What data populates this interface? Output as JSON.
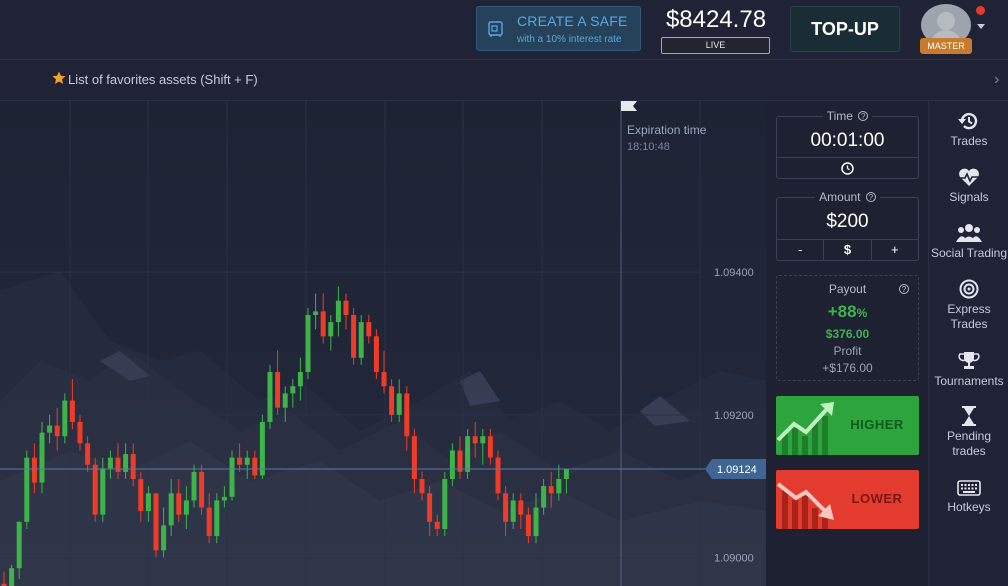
{
  "header": {
    "create_safe_title": "CREATE A SAFE",
    "create_safe_subtitle": "with a 10% interest rate",
    "balance": "$8424.78",
    "account_mode": "LIVE",
    "topup_label": "TOP-UP",
    "user_badge": "MASTER"
  },
  "favorites": {
    "label": "List of favorites assets (Shift + F)"
  },
  "chart": {
    "expiration_label": "Expiration time",
    "expiration_time": "18:10:48",
    "current_price": "1.09124",
    "price_ticks": [
      "1.09400",
      "1.09200",
      "1.09000"
    ],
    "colors": {
      "up": "#3db34a",
      "down": "#ef3b27",
      "background": "#1e2334"
    }
  },
  "chart_data": {
    "type": "candlestick",
    "price_ticks": [
      1.094,
      1.092,
      1.09
    ],
    "ylim": [
      1.0896,
      1.0964
    ],
    "current_price": 1.09124,
    "candles": [
      {
        "o": 1.08963,
        "h": 1.0898,
        "l": 1.0894,
        "c": 1.08945
      },
      {
        "o": 1.08945,
        "h": 1.0899,
        "l": 1.0892,
        "c": 1.08985
      },
      {
        "o": 1.08985,
        "h": 1.0905,
        "l": 1.0897,
        "c": 1.0905
      },
      {
        "o": 1.0905,
        "h": 1.0915,
        "l": 1.0904,
        "c": 1.0914
      },
      {
        "o": 1.0914,
        "h": 1.0916,
        "l": 1.0909,
        "c": 1.09105
      },
      {
        "o": 1.09105,
        "h": 1.0919,
        "l": 1.0909,
        "c": 1.09175
      },
      {
        "o": 1.09175,
        "h": 1.092,
        "l": 1.0916,
        "c": 1.09185
      },
      {
        "o": 1.09185,
        "h": 1.0921,
        "l": 1.0915,
        "c": 1.0917
      },
      {
        "o": 1.0917,
        "h": 1.0923,
        "l": 1.0916,
        "c": 1.0922
      },
      {
        "o": 1.0922,
        "h": 1.0925,
        "l": 1.0918,
        "c": 1.0919
      },
      {
        "o": 1.0919,
        "h": 1.092,
        "l": 1.0915,
        "c": 1.0916
      },
      {
        "o": 1.0916,
        "h": 1.0917,
        "l": 1.0912,
        "c": 1.0913
      },
      {
        "o": 1.0913,
        "h": 1.0914,
        "l": 1.0905,
        "c": 1.0906
      },
      {
        "o": 1.0906,
        "h": 1.0914,
        "l": 1.0905,
        "c": 1.09125
      },
      {
        "o": 1.09125,
        "h": 1.0915,
        "l": 1.0911,
        "c": 1.0914
      },
      {
        "o": 1.0914,
        "h": 1.0916,
        "l": 1.0911,
        "c": 1.0912
      },
      {
        "o": 1.0912,
        "h": 1.0916,
        "l": 1.0911,
        "c": 1.09145
      },
      {
        "o": 1.09145,
        "h": 1.0916,
        "l": 1.091,
        "c": 1.0911
      },
      {
        "o": 1.0911,
        "h": 1.0912,
        "l": 1.0905,
        "c": 1.09065
      },
      {
        "o": 1.09065,
        "h": 1.091,
        "l": 1.0905,
        "c": 1.0909
      },
      {
        "o": 1.0909,
        "h": 1.0909,
        "l": 1.09,
        "c": 1.0901
      },
      {
        "o": 1.0901,
        "h": 1.0907,
        "l": 1.09,
        "c": 1.09045
      },
      {
        "o": 1.09045,
        "h": 1.0911,
        "l": 1.0903,
        "c": 1.0909
      },
      {
        "o": 1.0909,
        "h": 1.0911,
        "l": 1.0905,
        "c": 1.0906
      },
      {
        "o": 1.0906,
        "h": 1.091,
        "l": 1.0904,
        "c": 1.0908
      },
      {
        "o": 1.0908,
        "h": 1.0913,
        "l": 1.0907,
        "c": 1.0912
      },
      {
        "o": 1.0912,
        "h": 1.0913,
        "l": 1.0906,
        "c": 1.0907
      },
      {
        "o": 1.0907,
        "h": 1.0909,
        "l": 1.0902,
        "c": 1.0903
      },
      {
        "o": 1.0903,
        "h": 1.0909,
        "l": 1.0902,
        "c": 1.0908
      },
      {
        "o": 1.0908,
        "h": 1.091,
        "l": 1.0907,
        "c": 1.09085
      },
      {
        "o": 1.09085,
        "h": 1.0915,
        "l": 1.0908,
        "c": 1.0914
      },
      {
        "o": 1.0914,
        "h": 1.0916,
        "l": 1.0912,
        "c": 1.0913
      },
      {
        "o": 1.0913,
        "h": 1.0915,
        "l": 1.0911,
        "c": 1.0914
      },
      {
        "o": 1.0914,
        "h": 1.0915,
        "l": 1.0911,
        "c": 1.09115
      },
      {
        "o": 1.09115,
        "h": 1.092,
        "l": 1.0911,
        "c": 1.0919
      },
      {
        "o": 1.0919,
        "h": 1.0927,
        "l": 1.0918,
        "c": 1.0926
      },
      {
        "o": 1.0926,
        "h": 1.0929,
        "l": 1.092,
        "c": 1.0921
      },
      {
        "o": 1.0921,
        "h": 1.0924,
        "l": 1.0919,
        "c": 1.0923
      },
      {
        "o": 1.0923,
        "h": 1.0925,
        "l": 1.0921,
        "c": 1.0924
      },
      {
        "o": 1.0924,
        "h": 1.0928,
        "l": 1.0922,
        "c": 1.0926
      },
      {
        "o": 1.0926,
        "h": 1.0935,
        "l": 1.0925,
        "c": 1.0934
      },
      {
        "o": 1.0934,
        "h": 1.0937,
        "l": 1.0932,
        "c": 1.09345
      },
      {
        "o": 1.09345,
        "h": 1.0937,
        "l": 1.093,
        "c": 1.0931
      },
      {
        "o": 1.0931,
        "h": 1.0934,
        "l": 1.0929,
        "c": 1.0933
      },
      {
        "o": 1.0933,
        "h": 1.0938,
        "l": 1.0931,
        "c": 1.0936
      },
      {
        "o": 1.0936,
        "h": 1.0937,
        "l": 1.0932,
        "c": 1.0934
      },
      {
        "o": 1.0934,
        "h": 1.0935,
        "l": 1.0927,
        "c": 1.0928
      },
      {
        "o": 1.0928,
        "h": 1.0934,
        "l": 1.0927,
        "c": 1.0933
      },
      {
        "o": 1.0933,
        "h": 1.0934,
        "l": 1.093,
        "c": 1.0931
      },
      {
        "o": 1.0931,
        "h": 1.0932,
        "l": 1.0925,
        "c": 1.0926
      },
      {
        "o": 1.0926,
        "h": 1.0929,
        "l": 1.0923,
        "c": 1.0924
      },
      {
        "o": 1.0924,
        "h": 1.0925,
        "l": 1.0919,
        "c": 1.092
      },
      {
        "o": 1.092,
        "h": 1.0925,
        "l": 1.0919,
        "c": 1.0923
      },
      {
        "o": 1.0923,
        "h": 1.0924,
        "l": 1.0915,
        "c": 1.0917
      },
      {
        "o": 1.0917,
        "h": 1.0918,
        "l": 1.0909,
        "c": 1.0911
      },
      {
        "o": 1.0911,
        "h": 1.0912,
        "l": 1.0908,
        "c": 1.0909
      },
      {
        "o": 1.0909,
        "h": 1.091,
        "l": 1.0903,
        "c": 1.0905
      },
      {
        "o": 1.0905,
        "h": 1.0906,
        "l": 1.0903,
        "c": 1.0904
      },
      {
        "o": 1.0904,
        "h": 1.0912,
        "l": 1.0903,
        "c": 1.0911
      },
      {
        "o": 1.0911,
        "h": 1.0916,
        "l": 1.091,
        "c": 1.0915
      },
      {
        "o": 1.0915,
        "h": 1.0917,
        "l": 1.0911,
        "c": 1.0912
      },
      {
        "o": 1.0912,
        "h": 1.0918,
        "l": 1.0911,
        "c": 1.0917
      },
      {
        "o": 1.0917,
        "h": 1.0919,
        "l": 1.0914,
        "c": 1.0916
      },
      {
        "o": 1.0916,
        "h": 1.0918,
        "l": 1.0913,
        "c": 1.0917
      },
      {
        "o": 1.0917,
        "h": 1.0918,
        "l": 1.0913,
        "c": 1.0914
      },
      {
        "o": 1.0914,
        "h": 1.0915,
        "l": 1.0908,
        "c": 1.0909
      },
      {
        "o": 1.0909,
        "h": 1.091,
        "l": 1.0903,
        "c": 1.0905
      },
      {
        "o": 1.0905,
        "h": 1.0909,
        "l": 1.0904,
        "c": 1.0908
      },
      {
        "o": 1.0908,
        "h": 1.0909,
        "l": 1.0904,
        "c": 1.0906
      },
      {
        "o": 1.0906,
        "h": 1.0907,
        "l": 1.0902,
        "c": 1.0903
      },
      {
        "o": 1.0903,
        "h": 1.0909,
        "l": 1.0902,
        "c": 1.0907
      },
      {
        "o": 1.0907,
        "h": 1.0911,
        "l": 1.0906,
        "c": 1.091
      },
      {
        "o": 1.091,
        "h": 1.0912,
        "l": 1.0907,
        "c": 1.0909
      },
      {
        "o": 1.0909,
        "h": 1.0913,
        "l": 1.0908,
        "c": 1.0911
      },
      {
        "o": 1.0911,
        "h": 1.0912,
        "l": 1.0909,
        "c": 1.09124
      }
    ]
  },
  "trade_panel": {
    "time_label": "Time",
    "time_value": "00:01:00",
    "amount_label": "Amount",
    "amount_value": "$200",
    "amount_minus": "-",
    "amount_currency": "$",
    "amount_plus": "+",
    "payout_label": "Payout",
    "payout_percent": "+88",
    "payout_percent_suffix": "%",
    "payout_amount": "$376.00",
    "profit_label": "Profit",
    "profit_value": "+$176.00",
    "higher_label": "HIGHER",
    "lower_label": "LOWER"
  },
  "sidenav": {
    "items": [
      {
        "label": "Trades",
        "icon": "history-icon"
      },
      {
        "label": "Signals",
        "icon": "heartbeat-icon"
      },
      {
        "label": "Social Trading",
        "icon": "users-icon"
      },
      {
        "label": "Express",
        "label2": "Trades",
        "icon": "target-icon"
      },
      {
        "label": "Tournaments",
        "icon": "trophy-icon"
      },
      {
        "label": "Pending",
        "label2": "trades",
        "icon": "hourglass-icon"
      },
      {
        "label": "Hotkeys",
        "icon": "keyboard-icon"
      }
    ]
  }
}
